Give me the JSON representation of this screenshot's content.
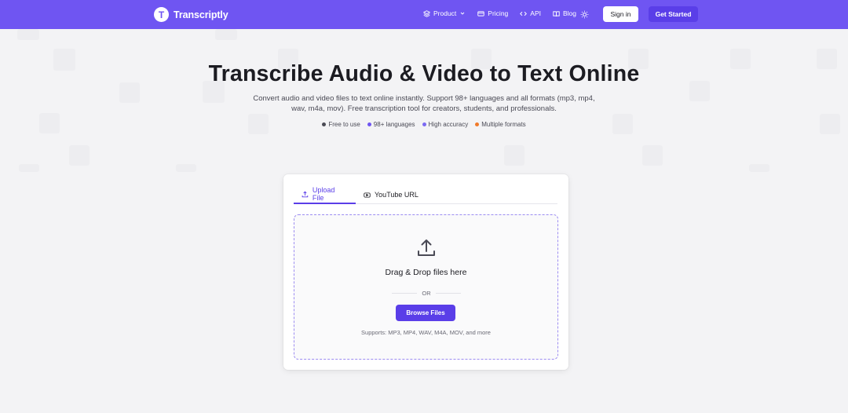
{
  "nav": {
    "logo_letter": "T",
    "brand": "Transcriptly",
    "links": [
      {
        "label": "Product",
        "icon": "layers-icon"
      },
      {
        "label": "Pricing",
        "icon": "credit-card-icon"
      },
      {
        "label": "API",
        "icon": "code-icon"
      },
      {
        "label": "Blog",
        "icon": "book-icon"
      }
    ],
    "theme_icon": "sun-icon",
    "signin_label": "Sign in",
    "get_started_label": "Get Started"
  },
  "hero": {
    "title": "Transcribe Audio & Video to Text Online",
    "subtitle": "Convert audio and video files to text online instantly. Support 98+ languages and all formats (mp3, mp4, wav, m4a, mov). Free transcription tool for creators, students, and professionals.",
    "features": [
      {
        "label": "Free to use",
        "color": "#4a4a55"
      },
      {
        "label": "98+ languages",
        "color": "#6f55f2"
      },
      {
        "label": "High accuracy",
        "color": "#7c6af2"
      },
      {
        "label": "Multiple formats",
        "color": "#f07a2a"
      }
    ]
  },
  "upload": {
    "tabs": [
      {
        "label": "Upload File",
        "icon": "upload-icon",
        "active": true
      },
      {
        "label": "YouTube URL",
        "icon": "youtube-icon",
        "active": false
      }
    ],
    "drop_title": "Drag & Drop files here",
    "or_label": "OR",
    "browse_label": "Browse Files",
    "supports_text": "Supports: MP3, MP4, WAV, M4A, MOV, and more"
  },
  "colors": {
    "brand": "#6f55f2",
    "accent": "#5a3ee8",
    "page_bg": "#f3f3f5"
  }
}
